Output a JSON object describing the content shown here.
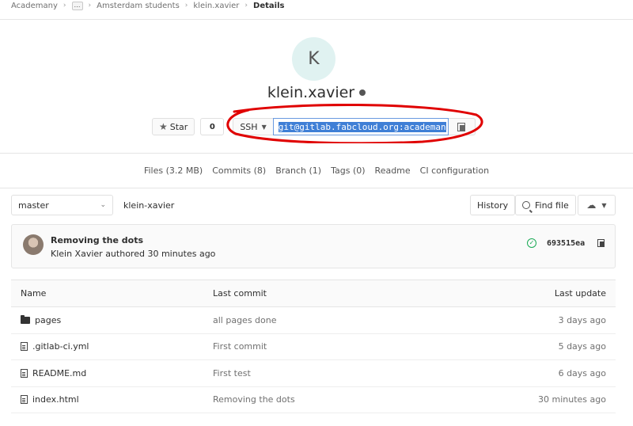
{
  "breadcrumb": {
    "items": [
      "Academany",
      "…",
      "Amsterdam students",
      "klein.xavier",
      "Details"
    ]
  },
  "project": {
    "avatar_letter": "K",
    "name": "klein.xavier",
    "visibility_icon": "globe-icon"
  },
  "actions": {
    "star_label": "Star",
    "star_count": "0",
    "clone_protocol": "SSH",
    "clone_url": "git@gitlab.fabcloud.org:academan"
  },
  "stats": {
    "items": [
      "Files (3.2 MB)",
      "Commits (8)",
      "Branch (1)",
      "Tags (0)",
      "Readme",
      "CI configuration"
    ]
  },
  "tree": {
    "branch": "master",
    "path": "klein-xavier",
    "history_label": "History",
    "find_file_label": "Find file"
  },
  "last_commit": {
    "title": "Removing the dots",
    "meta": "Klein Xavier authored 30 minutes ago",
    "sha": "693515ea",
    "status_color": "#1aaa55"
  },
  "table": {
    "headers": {
      "name": "Name",
      "commit": "Last commit",
      "date": "Last update"
    },
    "rows": [
      {
        "type": "folder",
        "name": "pages",
        "commit": "all pages done",
        "date": "3 days ago"
      },
      {
        "type": "file",
        "name": ".gitlab-ci.yml",
        "commit": "First commit",
        "date": "5 days ago"
      },
      {
        "type": "file",
        "name": "README.md",
        "commit": "First test",
        "date": "6 days ago"
      },
      {
        "type": "file",
        "name": "index.html",
        "commit": "Removing the dots",
        "date": "30 minutes ago"
      }
    ]
  },
  "annotation": {
    "color": "#e00000"
  }
}
